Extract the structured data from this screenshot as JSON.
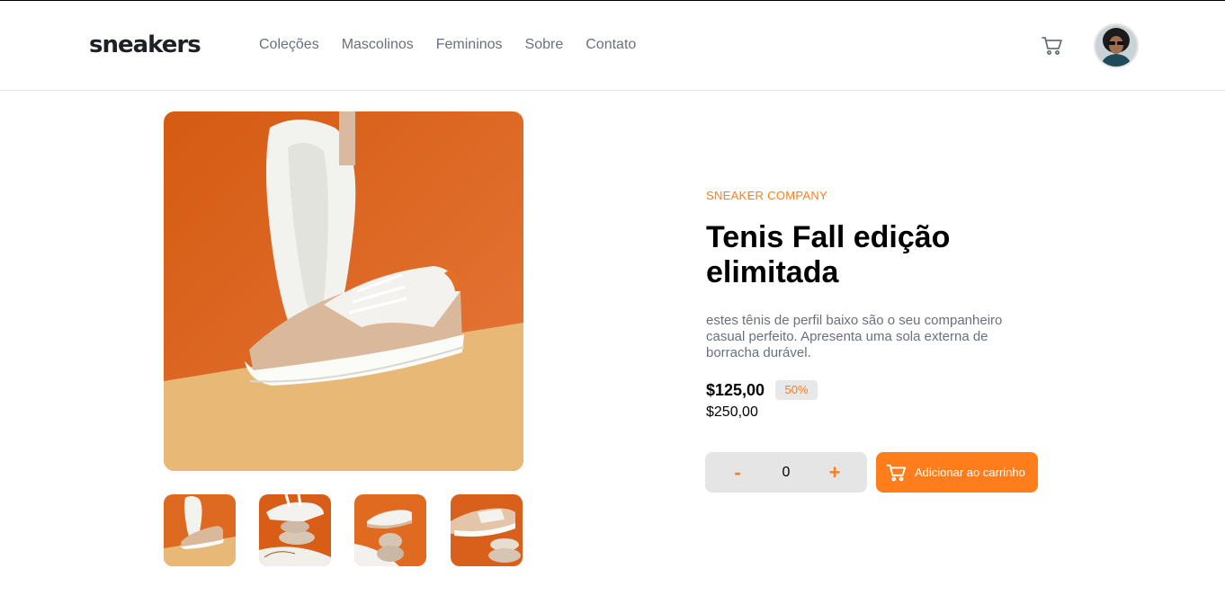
{
  "header": {
    "logo": "sneakers",
    "nav": [
      "Coleções",
      "Mascolinos",
      "Femininos",
      "Sobre",
      "Contato"
    ],
    "cart_icon": "cart-icon",
    "avatar_icon": "user-avatar"
  },
  "product": {
    "company": "SNEAKER COMPANY",
    "title": "Tenis Fall edição elimitada",
    "description": "estes tênis de perfil baixo são o seu companheiro casual perfeito. Apresenta uma sola externa de borracha durável.",
    "price": "$125,00",
    "discount": "50%",
    "original_price": "$250,00"
  },
  "quantity": {
    "minus": "-",
    "value": "0",
    "plus": "+"
  },
  "add_to_cart": {
    "label": "Adicionar ao carrinho",
    "icon": "cart-icon"
  },
  "colors": {
    "accent": "#ff7e1b",
    "text_dark": "#1d2026",
    "text_gray": "#69707d",
    "qty_bg": "#e5e5e5"
  }
}
